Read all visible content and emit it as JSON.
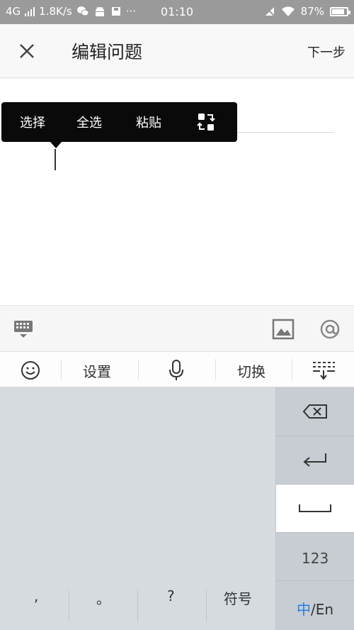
{
  "status_bar": {
    "network": "4G",
    "speed": "1.8K/s",
    "dots": "···",
    "time": "01:10",
    "battery_text": "87%",
    "battery_level": 0.87
  },
  "header": {
    "close_icon": "close-icon",
    "title": "编辑问题",
    "next_label": "下一步"
  },
  "context_menu": {
    "items": [
      "选择",
      "全选",
      "粘贴"
    ],
    "extra_icon": "swap-icon"
  },
  "toolbar": {
    "left_icon": "keyboard-toggle-icon",
    "image_icon": "image-icon",
    "mention_icon": "at-icon"
  },
  "ime_bar": {
    "emoji_icon": "emoji-icon",
    "settings_label": "设置",
    "mic_icon": "microphone-icon",
    "switch_label": "切换",
    "collapse_icon": "keyboard-collapse-icon"
  },
  "keyboard": {
    "right_keys": {
      "backspace_icon": "backspace-icon",
      "enter_icon": "enter-icon",
      "space_icon": "space-icon",
      "num_label": "123",
      "lang_zh": "中",
      "lang_en": "/En"
    },
    "bottom_keys": [
      ",",
      "。",
      "?",
      "符号"
    ],
    "accent_color": "#2a7de1"
  }
}
